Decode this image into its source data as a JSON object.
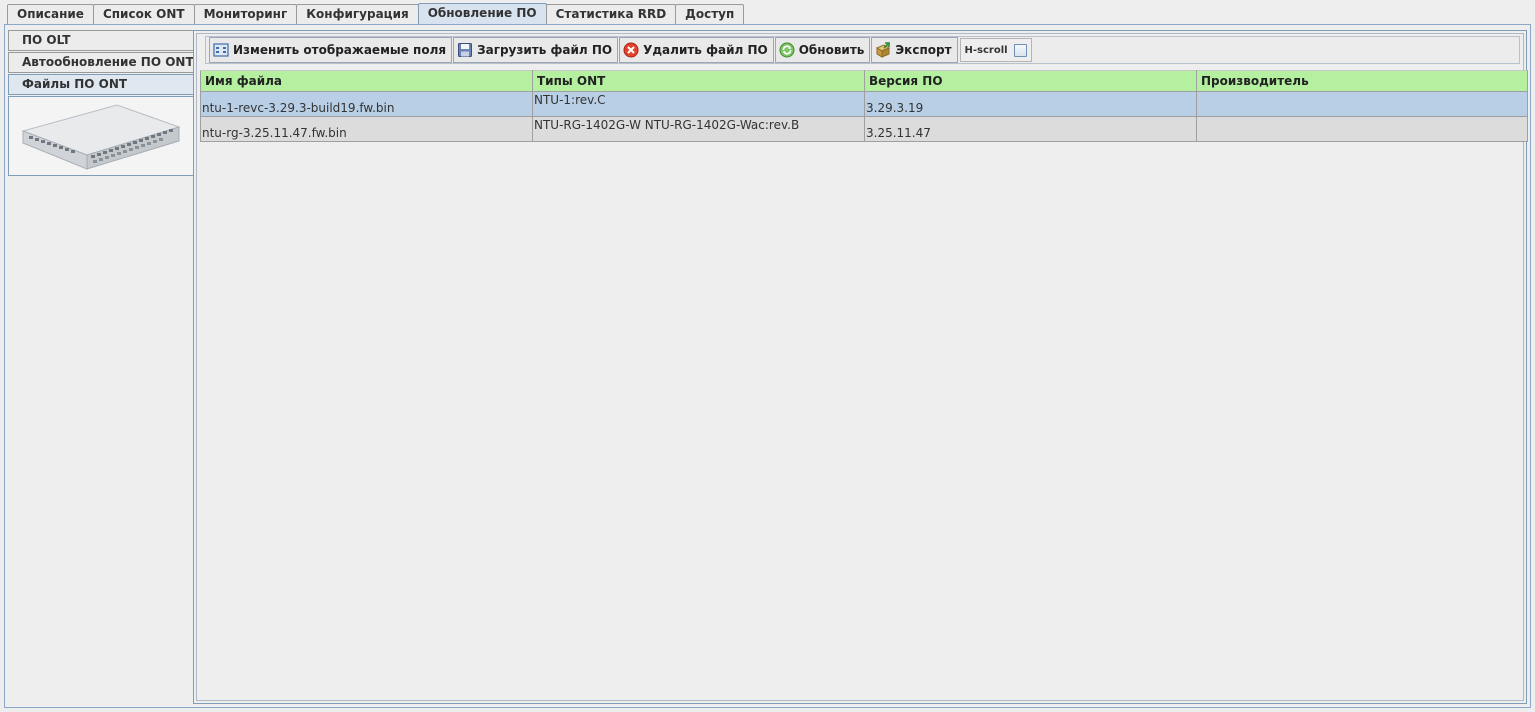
{
  "top_tabs": [
    {
      "label": "Описание"
    },
    {
      "label": "Список ONT"
    },
    {
      "label": "Мониторинг"
    },
    {
      "label": "Конфигурация"
    },
    {
      "label": "Обновление ПО",
      "active": true
    },
    {
      "label": "Статистика RRD"
    },
    {
      "label": "Доступ"
    }
  ],
  "side_tabs": [
    {
      "label": "ПО OLT"
    },
    {
      "label": "Автообновление ПО ONT"
    },
    {
      "label": "Файлы ПО ONT",
      "active": true
    }
  ],
  "toolbar": {
    "edit_fields": "Изменить отображаемые поля",
    "upload": "Загрузить файл ПО",
    "delete": "Удалить файл ПО",
    "refresh": "Обновить",
    "export": "Экспорт",
    "hscroll": "H-scroll"
  },
  "table": {
    "columns": [
      "Имя файла",
      "Типы ONT",
      "Версия ПО",
      "Производитель"
    ],
    "rows": [
      {
        "file": "ntu-1-revc-3.29.3-build19.fw.bin",
        "types": "NTU-1:rev.C",
        "version": "3.29.3.19",
        "vendor": "",
        "selected": true
      },
      {
        "file": "ntu-rg-3.25.11.47.fw.bin",
        "types": "NTU-RG-1402G-W NTU-RG-1402G-Wac:rev.B",
        "version": "3.25.11.47",
        "vendor": "",
        "selected": false
      }
    ]
  },
  "colors": {
    "header_bg": "#b4f0a0",
    "selected_row": "#b8cfe6",
    "row_bg": "#dcdcdc",
    "border_accent": "#7f9db9"
  },
  "icons": {
    "edit_fields": "fields-icon",
    "upload": "floppy-disk-icon",
    "delete": "delete-icon",
    "refresh": "refresh-icon",
    "export": "export-icon"
  }
}
